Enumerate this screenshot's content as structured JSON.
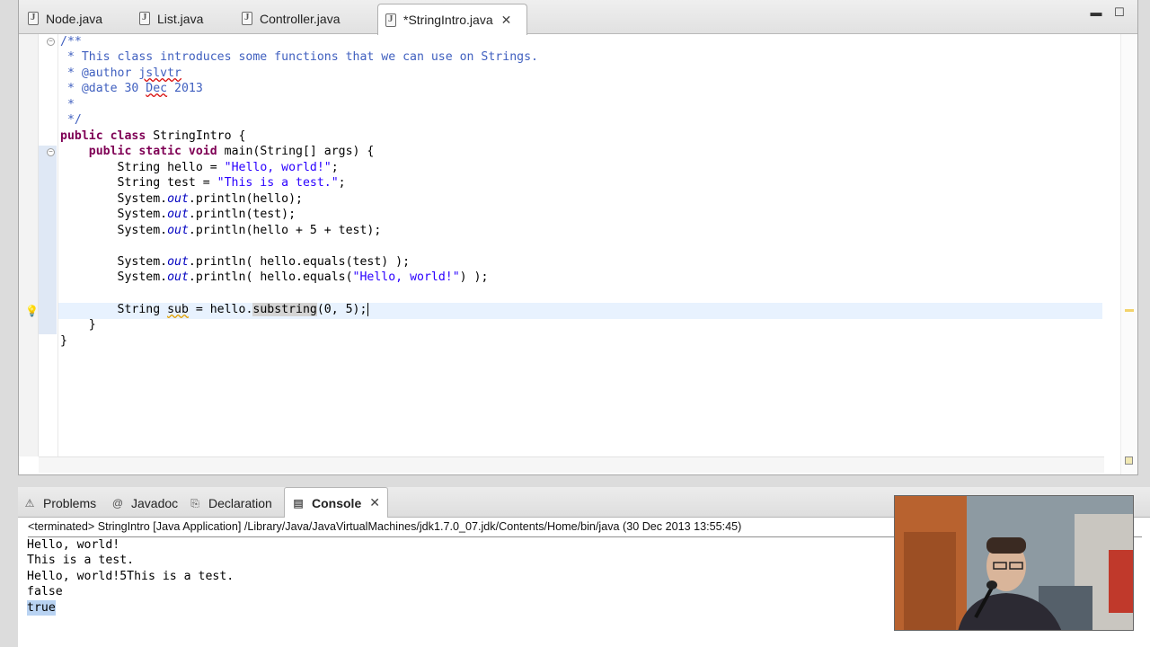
{
  "editor": {
    "tabs": [
      {
        "label": "Node.java",
        "active": false
      },
      {
        "label": "List.java",
        "active": false
      },
      {
        "label": "Controller.java",
        "active": false
      },
      {
        "label": "*StringIntro.java",
        "active": true
      }
    ],
    "close_glyph": "✕",
    "minimize_glyph": "▬",
    "maximize_glyph": "☐",
    "code_lines": [
      {
        "parts": [
          {
            "t": "/**",
            "c": "cm"
          }
        ]
      },
      {
        "parts": [
          {
            "t": " * This class introduces some functions that we can use on Strings.",
            "c": "cm"
          }
        ]
      },
      {
        "parts": [
          {
            "t": " * @author ",
            "c": "cm"
          },
          {
            "t": "jslvtr",
            "c": "cm squigr"
          }
        ]
      },
      {
        "parts": [
          {
            "t": " * @date 30 ",
            "c": "cm"
          },
          {
            "t": "Dec",
            "c": "cm squigr"
          },
          {
            "t": " 2013",
            "c": "cm"
          }
        ]
      },
      {
        "parts": [
          {
            "t": " *",
            "c": "cm"
          }
        ]
      },
      {
        "parts": [
          {
            "t": " */",
            "c": "cm"
          }
        ]
      },
      {
        "parts": [
          {
            "t": "public class",
            "c": "kw"
          },
          {
            "t": " StringIntro {",
            "c": ""
          }
        ]
      },
      {
        "parts": [
          {
            "t": "    ",
            "c": ""
          },
          {
            "t": "public static void",
            "c": "kw"
          },
          {
            "t": " main(String[] args) {",
            "c": ""
          }
        ]
      },
      {
        "parts": [
          {
            "t": "        String hello = ",
            "c": ""
          },
          {
            "t": "\"Hello, world!\"",
            "c": "st"
          },
          {
            "t": ";",
            "c": ""
          }
        ]
      },
      {
        "parts": [
          {
            "t": "        String test = ",
            "c": ""
          },
          {
            "t": "\"This is a test.\"",
            "c": "st"
          },
          {
            "t": ";",
            "c": ""
          }
        ]
      },
      {
        "parts": [
          {
            "t": "        System.",
            "c": ""
          },
          {
            "t": "out",
            "c": "fd"
          },
          {
            "t": ".println(hello);",
            "c": ""
          }
        ]
      },
      {
        "parts": [
          {
            "t": "        System.",
            "c": ""
          },
          {
            "t": "out",
            "c": "fd"
          },
          {
            "t": ".println(test);",
            "c": ""
          }
        ]
      },
      {
        "parts": [
          {
            "t": "        System.",
            "c": ""
          },
          {
            "t": "out",
            "c": "fd"
          },
          {
            "t": ".println(hello + 5 + test);",
            "c": ""
          }
        ]
      },
      {
        "parts": []
      },
      {
        "parts": [
          {
            "t": "        System.",
            "c": ""
          },
          {
            "t": "out",
            "c": "fd"
          },
          {
            "t": ".println( hello.equals(test) );",
            "c": ""
          }
        ]
      },
      {
        "parts": [
          {
            "t": "        System.",
            "c": ""
          },
          {
            "t": "out",
            "c": "fd"
          },
          {
            "t": ".println( hello.equals(",
            "c": ""
          },
          {
            "t": "\"Hello, world!\"",
            "c": "st"
          },
          {
            "t": ") );",
            "c": ""
          }
        ]
      },
      {
        "parts": []
      },
      {
        "parts": [
          {
            "t": "        String ",
            "c": ""
          },
          {
            "t": "sub",
            "c": "squig"
          },
          {
            "t": " = hello.",
            "c": ""
          },
          {
            "t": "substring",
            "c": "sel"
          },
          {
            "t": "(0, 5);",
            "c": ""
          },
          {
            "t": "",
            "c": "caret"
          }
        ]
      },
      {
        "parts": [
          {
            "t": "    }",
            "c": ""
          }
        ]
      },
      {
        "parts": [
          {
            "t": "}",
            "c": ""
          }
        ]
      }
    ]
  },
  "console": {
    "tabs": [
      {
        "label": "Problems",
        "icon": "problems-icon",
        "glyph": "⚠",
        "active": false
      },
      {
        "label": "Javadoc",
        "icon": "at-sign-icon",
        "glyph": "@",
        "active": false
      },
      {
        "label": "Declaration",
        "icon": "declaration-icon",
        "glyph": "⎘",
        "active": false
      },
      {
        "label": "Console",
        "icon": "console-icon",
        "glyph": "▤",
        "active": true
      }
    ],
    "status": "<terminated> StringIntro [Java Application] /Library/Java/JavaVirtualMachines/jdk1.7.0_07.jdk/Contents/Home/bin/java (30 Dec 2013 13:55:45)",
    "output": [
      {
        "text": "Hello, world!",
        "highlight": false
      },
      {
        "text": "This is a test.",
        "highlight": false
      },
      {
        "text": "Hello, world!5This is a test.",
        "highlight": false
      },
      {
        "text": "false",
        "highlight": false
      },
      {
        "text": "true",
        "highlight": true
      }
    ]
  },
  "colors": {
    "keyword": "#7f0055",
    "comment": "#3f5fbf",
    "string": "#2a00ff",
    "field": "#0000c0",
    "current_line": "#e8f2fe",
    "selection": "#b9d3f2"
  }
}
